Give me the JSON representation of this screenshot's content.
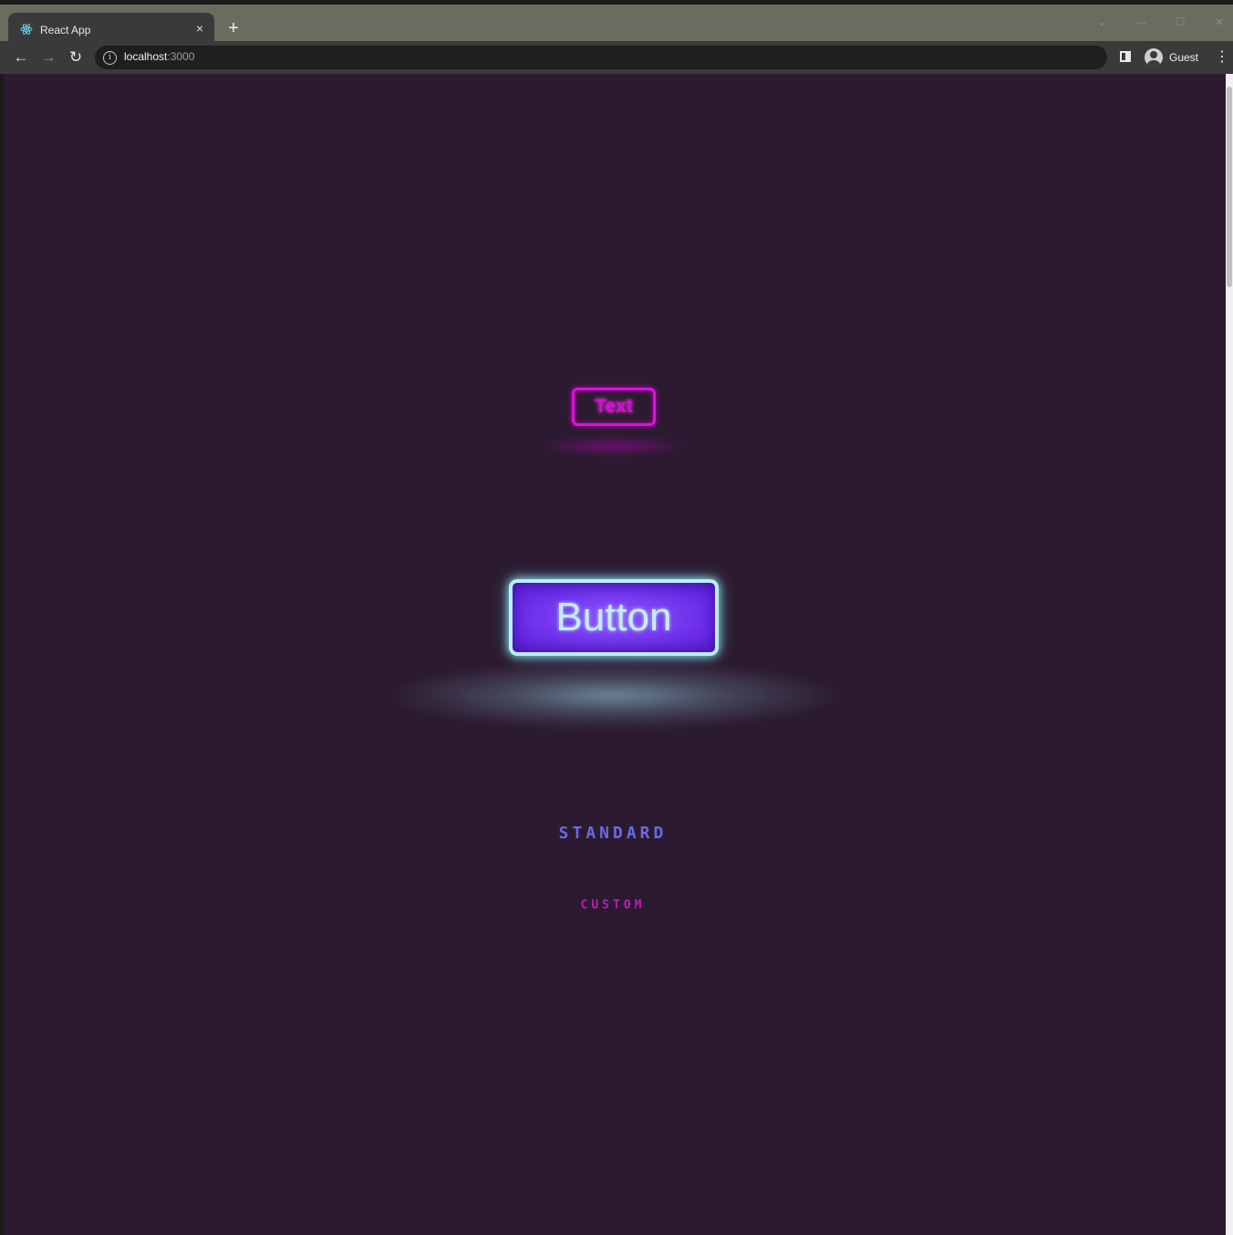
{
  "browser": {
    "tab_title": "React App",
    "tab_close": "×",
    "new_tab": "+",
    "url_host": "localhost",
    "url_port": ":3000",
    "profile_name": "Guest",
    "icons": {
      "favicon": "react-icon",
      "back": "back-arrow-icon",
      "forward": "forward-arrow-icon",
      "reload": "reload-icon",
      "info": "info-icon",
      "side_panel": "side-panel-icon",
      "profile": "profile-avatar-icon",
      "menu": "kebab-menu-icon"
    },
    "glyphs": {
      "back": "←",
      "forward": "→",
      "reload": "↻",
      "info": "i",
      "menu": "⋮",
      "tab_search": "⌄",
      "minimize": "—",
      "maximize": "☐",
      "close": "✕"
    }
  },
  "page": {
    "text_badge": "Text",
    "button_label": "Button",
    "standard_label": "STANDARD",
    "custom_label": "CUSTOM",
    "colors": {
      "background": "#2c1b30",
      "text_badge": "#e010e0",
      "button_fill": "#6a2ae6",
      "button_border": "#b9f0f6",
      "standard": "#6a6ae6",
      "custom": "#c018b8"
    }
  }
}
